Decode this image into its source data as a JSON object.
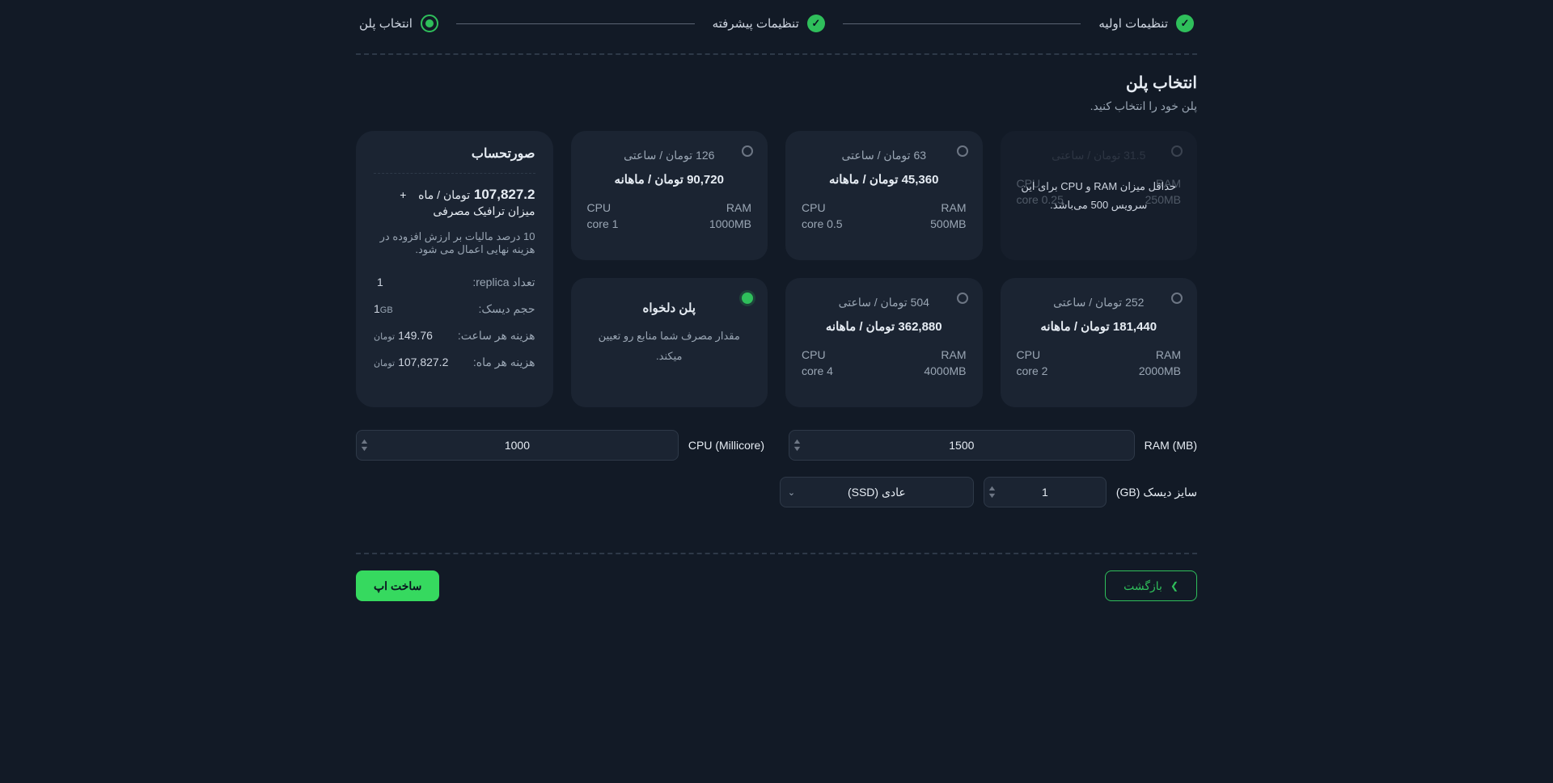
{
  "stepper": {
    "steps": [
      {
        "label": "تنظیمات اولیه",
        "state": "done"
      },
      {
        "label": "تنظیمات پیشرفته",
        "state": "done"
      },
      {
        "label": "انتخاب پلن",
        "state": "current"
      }
    ]
  },
  "heading": {
    "title": "انتخاب پلن",
    "subtitle": "پلن خود را انتخاب کنید."
  },
  "plans": [
    {
      "hourly": "31.5 تومان / ساعتی",
      "monthly": "",
      "ram_label": "RAM",
      "ram": "250MB",
      "cpu_label": "CPU",
      "cpu": "0.25 core",
      "disabled": true,
      "overlay": "حداقل میزان RAM و CPU برای این سرویس 500 می‌باشد."
    },
    {
      "hourly": "63 تومان / ساعتی",
      "monthly": "45,360 تومان / ماهانه",
      "ram_label": "RAM",
      "ram": "500MB",
      "cpu_label": "CPU",
      "cpu": "0.5 core",
      "disabled": false,
      "selected": false
    },
    {
      "hourly": "126 تومان / ساعتی",
      "monthly": "90,720 تومان / ماهانه",
      "ram_label": "RAM",
      "ram": "1000MB",
      "cpu_label": "CPU",
      "cpu": "1 core",
      "disabled": false,
      "selected": false
    },
    {
      "hourly": "252 تومان / ساعتی",
      "monthly": "181,440 تومان / ماهانه",
      "ram_label": "RAM",
      "ram": "2000MB",
      "cpu_label": "CPU",
      "cpu": "2 core",
      "disabled": false,
      "selected": false
    },
    {
      "hourly": "504 تومان / ساعتی",
      "monthly": "362,880 تومان / ماهانه",
      "ram_label": "RAM",
      "ram": "4000MB",
      "cpu_label": "CPU",
      "cpu": "4 core",
      "disabled": false,
      "selected": false
    }
  ],
  "custom_plan": {
    "title": "پلن دلخواه",
    "desc": "مقدار مصرف شما منابع رو تعیین میکند.",
    "selected": true
  },
  "bill": {
    "title": "صورتحساب",
    "big_value": "107,827.2",
    "big_unit": "تومان / ماه",
    "big_extra": "+ میزان ترافیک مصرفی",
    "note": "10 درصد مالیات بر ارزش افزوده در هزینه نهایی اعمال می شود.",
    "lines": [
      {
        "lab": "تعداد replica:",
        "val": "1",
        "unit": ""
      },
      {
        "lab": "حجم دیسک:",
        "val": "1",
        "unit": "GB"
      },
      {
        "lab": "هزینه هر ساعت:",
        "val": "149.76",
        "unit": "تومان"
      },
      {
        "lab": "هزینه هر ماه:",
        "val": "107,827.2",
        "unit": "تومان"
      }
    ]
  },
  "inputs": {
    "ram_label": "RAM (MB)",
    "ram_value": "1500",
    "cpu_label": "CPU (Millicore)",
    "cpu_value": "1000"
  },
  "disk": {
    "label": "سایز دیسک (GB)",
    "value": "1",
    "type": "عادی (SSD)"
  },
  "footer": {
    "back": "بازگشت",
    "create": "ساخت اپ"
  }
}
